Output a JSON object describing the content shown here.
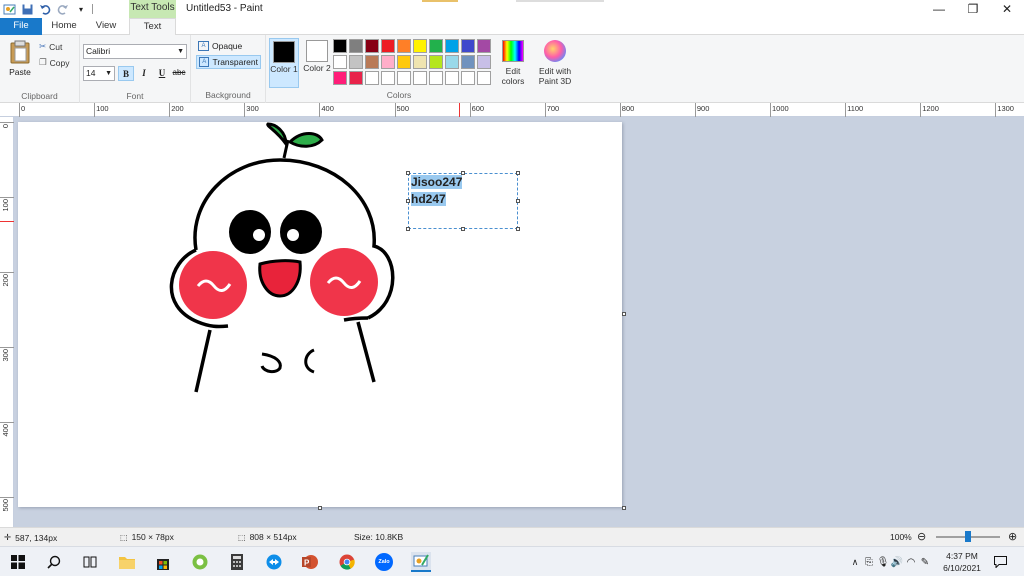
{
  "window": {
    "title": "Untitled53 - Paint",
    "context_tab_header": "Text Tools",
    "controls": [
      "minimize",
      "restore",
      "close"
    ]
  },
  "tabs": [
    {
      "label": "File"
    },
    {
      "label": "Home"
    },
    {
      "label": "View"
    },
    {
      "label": "Text"
    }
  ],
  "ribbon": {
    "clipboard": {
      "paste": "Paste",
      "cut": "Cut",
      "copy": "Copy",
      "label": "Clipboard"
    },
    "font": {
      "family": "Calibri",
      "size": "14",
      "bold": "B",
      "italic": "I",
      "underline": "U",
      "strikethrough": "abc",
      "label": "Font"
    },
    "background": {
      "opaque": "Opaque",
      "transparent": "Transparent",
      "label": "Background"
    },
    "colors": {
      "color1": "Color 1",
      "color2": "Color 2",
      "color1_value": "#000000",
      "color2_value": "#ffffff",
      "edit_colors": "Edit colors",
      "edit_paint3d": "Edit with Paint 3D",
      "label": "Colors",
      "palette": [
        "#000000",
        "#7f7f7f",
        "#880015",
        "#ed1c24",
        "#ff7f27",
        "#fff200",
        "#22b14c",
        "#00a2e8",
        "#3f48cc",
        "#a349a4",
        "#ffffff",
        "#c3c3c3",
        "#b97a57",
        "#ffaec9",
        "#ffc90e",
        "#efe4b0",
        "#b5e61d",
        "#99d9ea",
        "#7092be",
        "#c8bfe7",
        "#ff1d78",
        "#e8234a",
        "#ffffff",
        "#ffffff",
        "#ffffff",
        "#ffffff",
        "#ffffff",
        "#ffffff",
        "#ffffff",
        "#ffffff"
      ]
    }
  },
  "ruler": {
    "h_labels": [
      "0",
      "100",
      "200",
      "300",
      "400",
      "500",
      "600",
      "700",
      "800",
      "900",
      "1000",
      "1100",
      "1200",
      "1300"
    ],
    "v_labels": [
      "0",
      "100",
      "200",
      "300",
      "400",
      "500"
    ]
  },
  "canvas": {
    "text_lines": [
      "Jisoo247",
      "hd247"
    ]
  },
  "statusbar": {
    "cursor": "587, 134px",
    "selection": "150 × 78px",
    "image_size": "808 × 514px",
    "file_size": "Size: 10.8KB",
    "zoom": "100%"
  },
  "taskbar": {
    "time": "4:37 PM",
    "date": "6/10/2021",
    "icons": [
      "windows-start-icon",
      "search-icon",
      "task-view-icon",
      "file-explorer-icon",
      "store-icon",
      "coc-coc-icon",
      "calculator-icon",
      "teamviewer-icon",
      "powerpoint-icon",
      "chrome-icon",
      "zalo-icon",
      "paint-icon"
    ],
    "zalo_label": "Zalo"
  },
  "colors": {
    "accent": "#1979ca",
    "selection": "#99c9ef",
    "workspace": "#c8d1e0"
  }
}
